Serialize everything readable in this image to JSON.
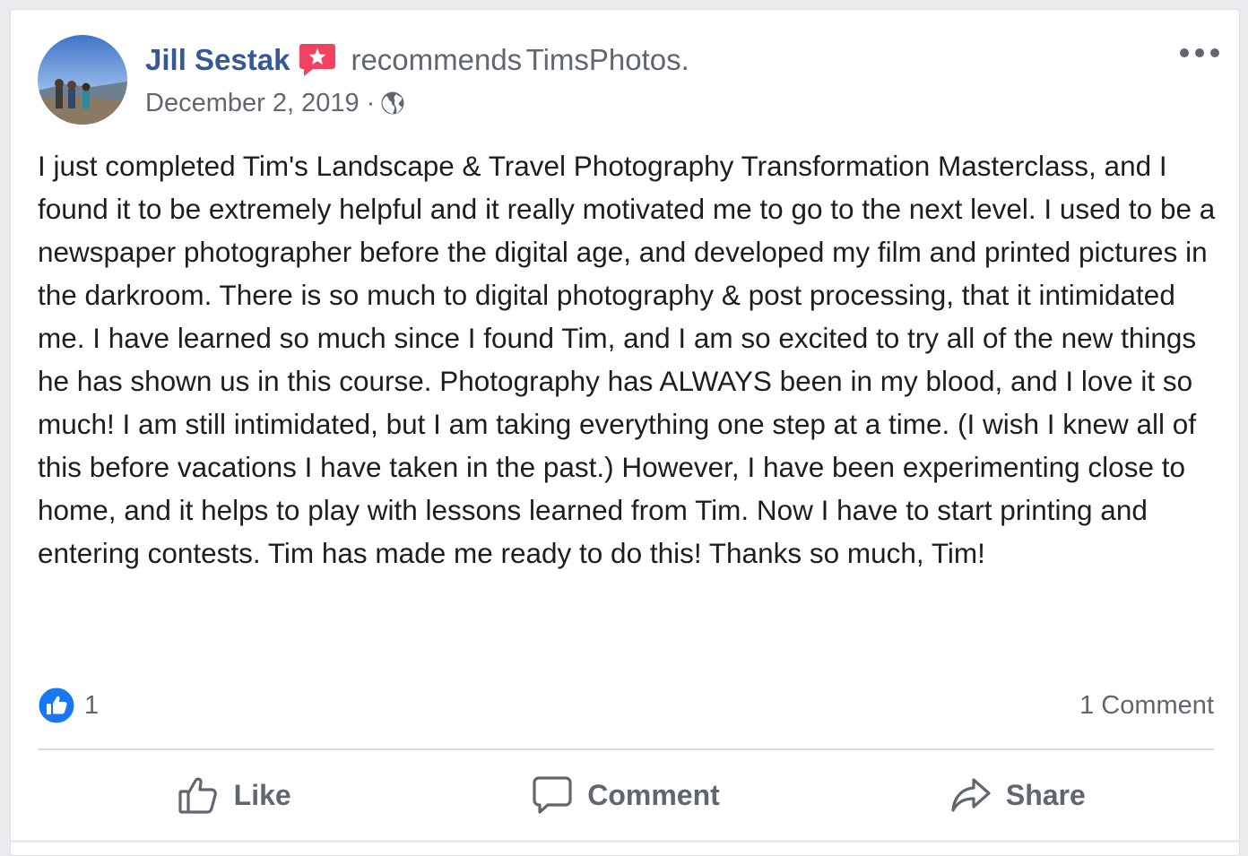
{
  "post": {
    "author": "Jill Sestak",
    "recommends_text": "recommends",
    "page_name": "TimsPhotos.",
    "date": "December 2, 2019",
    "separator": "·",
    "privacy_icon": "globe-icon",
    "menu_icon": "more-horizontal-icon",
    "badge_icon": "recommendation-star-icon",
    "body": "I just completed Tim's Landscape & Travel Photography Transformation Masterclass, and I found it to be extremely helpful and it really motivated me to go to the next level. I used to be a newspaper photographer before the digital age, and developed my film and printed pictures in the darkroom. There is so much to digital photography & post processing, that it intimidated me. I have learned so much since I found Tim, and I am so excited to try all of the new things he has shown us in this course. Photography has ALWAYS been in my blood, and I love it so much! I am still intimidated, but I am taking everything one step at a time. (I wish I knew all of this before vacations I have taken in the past.) However, I have been experimenting close to home, and it helps to play with lessons learned from Tim. Now I have to start printing and entering contests. Tim has made me ready to do this! Thanks so much, Tim!"
  },
  "stats": {
    "like_count": "1",
    "comments": "1 Comment"
  },
  "actions": {
    "like": "Like",
    "comment": "Comment",
    "share": "Share"
  },
  "colors": {
    "author_link": "#365899",
    "secondary_text": "#606770",
    "body_text": "#1c1e21",
    "like_blue": "#1877f2",
    "badge_red": "#f3425f"
  }
}
